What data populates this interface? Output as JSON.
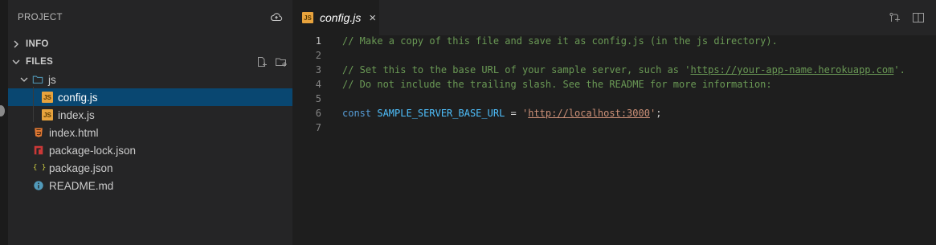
{
  "sidebar": {
    "title": "PROJECT",
    "sections": {
      "info": "INFO",
      "files": "FILES"
    },
    "tree": {
      "folder_js": "js",
      "config": "config.js",
      "index_js": "index.js",
      "index_html": "index.html",
      "package_lock": "package-lock.json",
      "package_json": "package.json",
      "readme": "README.md"
    },
    "icons": {
      "js": "JS",
      "json": "{ }"
    }
  },
  "editor": {
    "tab": {
      "title": "config.js",
      "close": "×"
    },
    "lines": [
      {
        "n": "1",
        "comment": "// Make a copy of this file and save it as config.js (in the js directory)."
      },
      {
        "n": "2"
      },
      {
        "n": "3",
        "pre": "// Set this to the base URL of your sample server, such as '",
        "link": "https://your-app-name.herokuapp.com",
        "post": "'."
      },
      {
        "n": "4",
        "comment": "// Do not include the trailing slash. See the README for more information:"
      },
      {
        "n": "5"
      },
      {
        "n": "6",
        "kw": "const",
        "name": "SAMPLE_SERVER_BASE_URL",
        "op": " = ",
        "q1": "'",
        "url": "http://localhost:3000",
        "q2": "'",
        "end": ";"
      },
      {
        "n": "7"
      }
    ]
  },
  "colors": {
    "selection": "#094771",
    "comment": "#6a9955",
    "keyword": "#569cd6",
    "constant": "#4fc1ff",
    "string": "#ce9178",
    "js_badge": "#e8a33d",
    "html_icon": "#e37933",
    "npm_icon": "#cb3837",
    "json_icon": "#cbcb41",
    "info_icon": "#519aba",
    "folder_icon": "#519aba"
  }
}
